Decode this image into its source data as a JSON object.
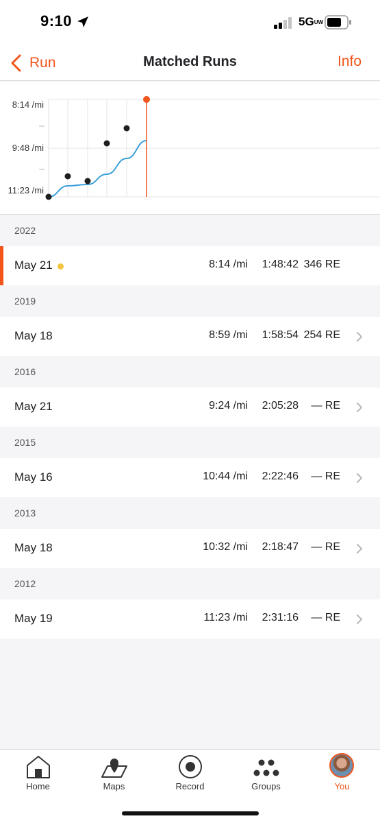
{
  "status_bar": {
    "time": "9:10",
    "network": "5G",
    "network_suffix": "UW"
  },
  "nav": {
    "back_label": "Run",
    "title": "Matched Runs",
    "info_label": "Info"
  },
  "chart_data": {
    "type": "scatter",
    "title": "",
    "ylabel": "",
    "y_tick_labels": [
      "8:14 /mi",
      "9:48 /mi",
      "11:23 /mi"
    ],
    "y_inverted": true,
    "x_year": [
      2012,
      2013,
      2015,
      2016,
      2019,
      2022
    ],
    "y_pace_sec": [
      683,
      632,
      644,
      564,
      539,
      494
    ],
    "trend_line": true,
    "trend_color": "#3aa0d8",
    "current_marker_color": "#f2541b",
    "point_color": "#1e1e1e"
  },
  "runs": [
    {
      "year": "2022",
      "date": "May 21",
      "pace": "8:14 /mi",
      "time": "1:48:42",
      "re": "346 RE",
      "current": true,
      "chevron": false
    },
    {
      "year": "2019",
      "date": "May 18",
      "pace": "8:59 /mi",
      "time": "1:58:54",
      "re": "254 RE",
      "current": false,
      "chevron": true
    },
    {
      "year": "2016",
      "date": "May 21",
      "pace": "9:24 /mi",
      "time": "2:05:28",
      "re": "— RE",
      "current": false,
      "chevron": true
    },
    {
      "year": "2015",
      "date": "May 16",
      "pace": "10:44 /mi",
      "time": "2:22:46",
      "re": "— RE",
      "current": false,
      "chevron": true
    },
    {
      "year": "2013",
      "date": "May 18",
      "pace": "10:32 /mi",
      "time": "2:18:47",
      "re": "— RE",
      "current": false,
      "chevron": true
    },
    {
      "year": "2012",
      "date": "May 19",
      "pace": "11:23 /mi",
      "time": "2:31:16",
      "re": "— RE",
      "current": false,
      "chevron": true
    }
  ],
  "tabs": [
    {
      "label": "Home",
      "icon": "home-icon",
      "active": false
    },
    {
      "label": "Maps",
      "icon": "maps-icon",
      "active": false
    },
    {
      "label": "Record",
      "icon": "record-icon",
      "active": false
    },
    {
      "label": "Groups",
      "icon": "groups-icon",
      "active": false
    },
    {
      "label": "You",
      "icon": "avatar",
      "active": true
    }
  ],
  "colors": {
    "accent": "#f2541b",
    "highlight_dot": "#f4c542",
    "trend": "#3aa0d8"
  }
}
